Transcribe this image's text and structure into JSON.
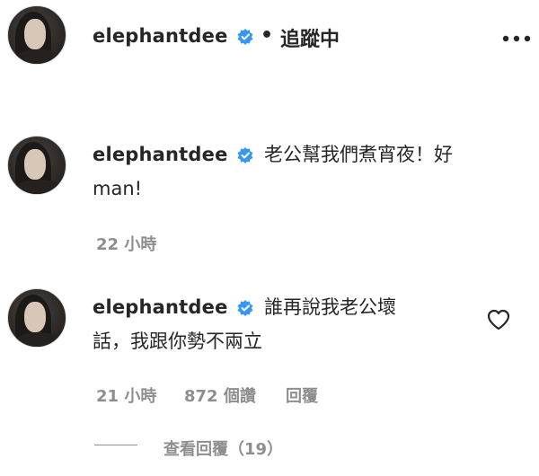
{
  "header": {
    "username": "elephantdee",
    "dot": "•",
    "follow_status": "追蹤中",
    "more_icon": "more-horizontal-icon"
  },
  "comments": [
    {
      "username": "elephantdee",
      "text_line1": "老公幫我們煮宵夜！好",
      "text_line2": "man!",
      "time": "22 小時"
    },
    {
      "username": "elephantdee",
      "text_line1": "誰再說我老公壞",
      "text_line2": "話，我跟你勢不兩立",
      "time": "21 小時",
      "likes": "872 個讚",
      "reply": "回覆",
      "view_replies": "查看回覆（19）",
      "like_icon": "heart-outline-icon"
    }
  ],
  "colors": {
    "text": "#262626",
    "secondary": "#8e8e8e",
    "verified_blue": "#3897f0"
  }
}
